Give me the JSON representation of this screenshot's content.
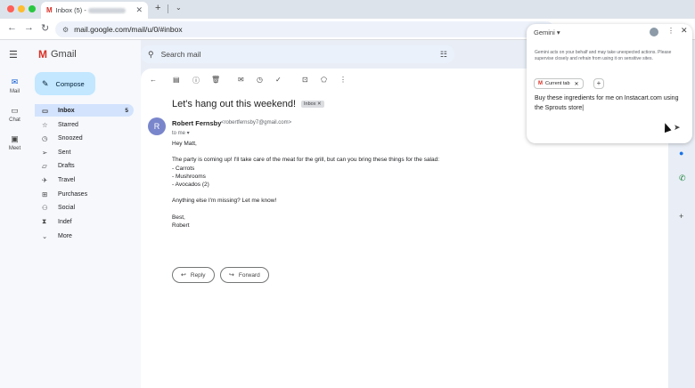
{
  "browser": {
    "tab_title": "Inbox (5) -",
    "tab_logo": "M",
    "new_tab": "+",
    "tab_menu": "⌄",
    "url": "mail.google.com/mail/u/0/#inbox"
  },
  "rail": {
    "items": [
      {
        "label": "Mail",
        "icon": "mail-icon"
      },
      {
        "label": "Chat",
        "icon": "chat-icon"
      },
      {
        "label": "Meet",
        "icon": "video-icon"
      }
    ]
  },
  "sidebar": {
    "app_name": "Gmail",
    "compose_label": "Compose",
    "folders": [
      {
        "label": "Inbox",
        "count": "5",
        "icon": "inbox-icon"
      },
      {
        "label": "Starred",
        "count": "",
        "icon": "star-icon"
      },
      {
        "label": "Snoozed",
        "count": "",
        "icon": "clock-icon"
      },
      {
        "label": "Sent",
        "count": "",
        "icon": "send-icon"
      },
      {
        "label": "Drafts",
        "count": "",
        "icon": "draft-icon"
      },
      {
        "label": "Travel",
        "count": "",
        "icon": "plane-icon"
      },
      {
        "label": "Purchases",
        "count": "",
        "icon": "cart-icon"
      },
      {
        "label": "Social",
        "count": "",
        "icon": "people-icon"
      },
      {
        "label": "Indef",
        "count": "",
        "icon": "hourglass-icon"
      },
      {
        "label": "More",
        "count": "",
        "icon": "chevron-down-icon"
      }
    ]
  },
  "search": {
    "placeholder": "Search mail"
  },
  "email": {
    "subject": "Let's hang out this weekend!",
    "label": "Inbox ✕",
    "sender_initial": "R",
    "sender_name": "Robert Fernsby",
    "sender_email": "<robertfernsby7@gmail.com>",
    "to_line": "to me ▾",
    "body": [
      "Hey Matt,",
      "",
      "The party is coming up! I'll take care of the meat for the grill, but can you bring these things for the salad:",
      "- Carrots",
      "- Mushrooms",
      "- Avocados (2)",
      "",
      "Anything else I'm missing? Let me know!",
      "",
      "Best,",
      "Robert"
    ],
    "reply_label": "Reply",
    "forward_label": "Forward"
  },
  "gemini": {
    "title": "Gemini ▾",
    "warning": "Gemini acts on your behalf and may take unexpected actions. Please supervise closely and refrain from using it on sensitive sites.",
    "chip_label": "Current tab",
    "prompt": "Buy these ingredients for me on Instacart.com using the Sprouts store|"
  },
  "colors": {
    "accent": "#0b57d0",
    "compose_bg": "#c2e7ff",
    "active_folder_bg": "#d3e3fd"
  }
}
